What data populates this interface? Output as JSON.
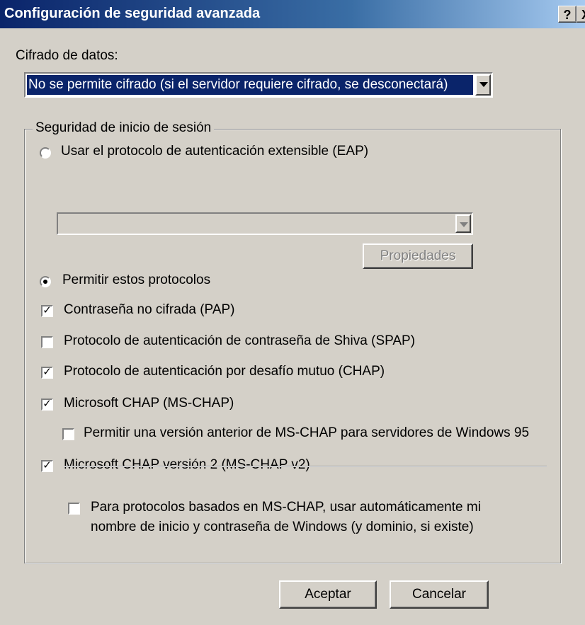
{
  "window": {
    "title": "Configuración de seguridad avanzada",
    "help_label": "?",
    "close_label": "X"
  },
  "encryption": {
    "label": "Cifrado de datos:",
    "selected": "No se permite cifrado (si el servidor requiere cifrado, se desconectará)"
  },
  "logon_security": {
    "group_label": "Seguridad de inicio de sesión",
    "eap_radio_label": "Usar el protocolo de autenticación extensible (EAP)",
    "eap_radio_selected": false,
    "eap_combo_value": "",
    "properties_button": "Propiedades",
    "allow_radio_label": "Permitir estos protocolos",
    "allow_radio_selected": true,
    "protocols": [
      {
        "label": "Contraseña no cifrada (PAP)",
        "checked": true
      },
      {
        "label": "Protocolo de autenticación de contraseña de Shiva (SPAP)",
        "checked": false
      },
      {
        "label": "Protocolo de autenticación por desafío mutuo (CHAP)",
        "checked": true
      },
      {
        "label": "Microsoft CHAP (MS-CHAP)",
        "checked": true
      },
      {
        "label": "Permitir una versión anterior de MS-CHAP para servidores de Windows 95",
        "checked": false
      },
      {
        "label": "Microsoft CHAP versión 2 (MS-CHAP v2)",
        "checked": true
      }
    ],
    "auto_logon": {
      "label_line1": "Para protocolos basados en MS-CHAP, usar automáticamente mi",
      "label_line2": "nombre de inicio y contraseña de Windows (y dominio, si existe)",
      "checked": false
    }
  },
  "buttons": {
    "ok": "Aceptar",
    "cancel": "Cancelar"
  }
}
